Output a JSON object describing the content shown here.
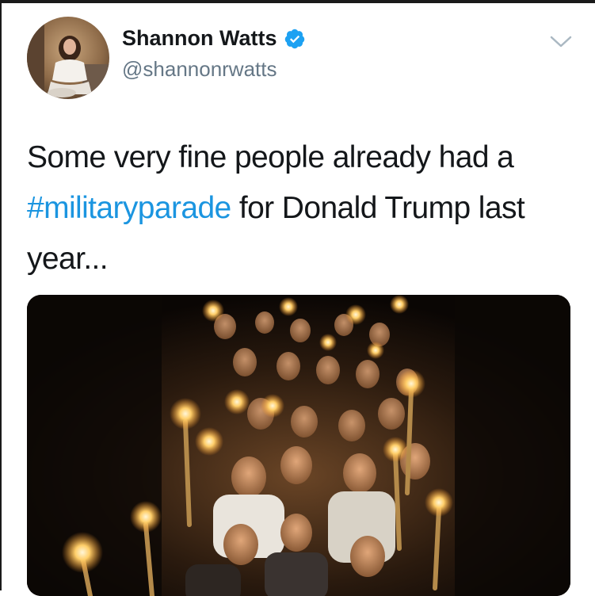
{
  "user": {
    "display_name": "Shannon Watts",
    "handle": "@shannonrwatts",
    "verified": true
  },
  "tweet": {
    "text_part1": "Some very fine people already had a ",
    "hashtag": "#militaryparade",
    "text_part2": " for Donald Trump last year..."
  },
  "media": {
    "description_icon": "photo-torch-march"
  },
  "icons": {
    "verified": "verified-badge-icon",
    "menu": "chevron-down-icon"
  },
  "colors": {
    "hashtag": "#1b95e0",
    "verified": "#1da1f2",
    "handle": "#657786",
    "text": "#14171a"
  }
}
